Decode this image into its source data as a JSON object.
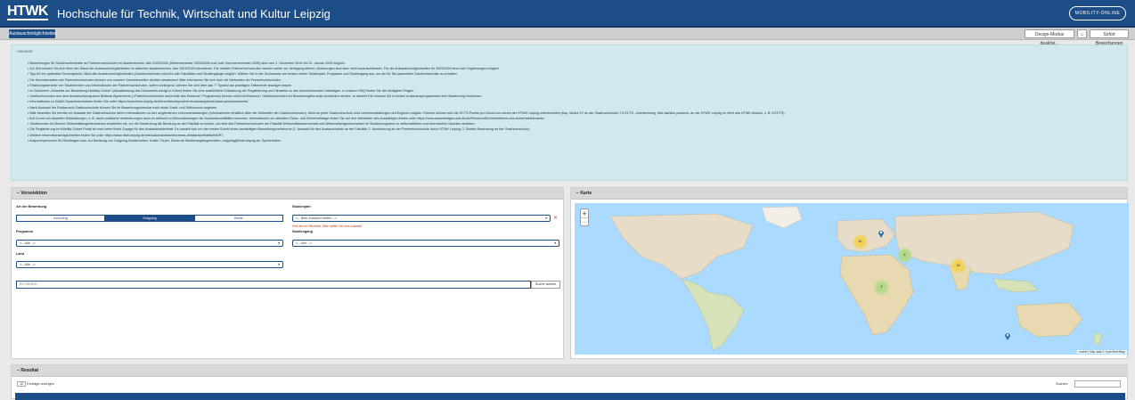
{
  "header": {
    "logo": "HTWK",
    "title": "Hochschule für Technik, Wirtschaft und Kultur Leipzig",
    "partner_logo": "MOBILITY-ONLINE"
  },
  "toolbar": {
    "left_button": "Austauschmöglichkeiten",
    "design_mode": "Design-Modus deaktivi...",
    "home_icon": "home-icon",
    "fav_button": "Sofort Bewerbungen"
  },
  "info": {
    "title": "HINWEISE",
    "items": [
      "Bewerbungen für Studienaufenthalte an Partnerhochschulen im Akademischen Jahr 2025/2026 (Wintersemester 2025/2026 und/ oder Sommersemester 2026) sind vom 1. Dezember 2024 bis 31. Januar 2025 möglich.",
      "Zur Zeit können Sie sich über den Stand der Austauschmöglichkeiten im aktuellen Akademischen Jahr 2024/2025 informieren. Die meisten Partnerhochschulen werden weiter zur Verfügung stehen, Änderungen sind aber nicht auszuschliessen. Für die Austauschmöglichkeiten für 2025/2026 sind noch Ergänzungen möglich.",
      "Tipp für ein optimales Suchergebnis: Nicht alle Austauschmöglichkeiten (Gasthochschulen) sind für alle Fakultäten und Studiengänge möglich. Wählen Sie in der Suchmaske am besten immer Studienjahr, Programm und Studiengang aus, um die für Sie passenden Gasthochschulen zu erhalten.",
      "Die Semesterzeiten der Partnerhochschulen können von unseren Semesterzeiten deutlich abweichen! Bitte informieren Sie sich über die Webseiten der Partnerhochschulen.",
      "Erfahrungsberichte von Studierenden und Informationen der Partnerhochschulen, sofern vorliegend, können Sie sich über das \"i\" Symbol am jeweiligen Zeilenende anzeigen lassen.",
      "Im Dokument „Hinweise zur Bewerbung Mobility-Online\" (Aktualisierung des Dokuments erfolgt in Kürze) finden Sie eine ausführliche Erläuterung der Registrierung und Hinweise zu den einzureichenden Unterlagen. In unseren FAQ finden Sie die häufigsten Fragen.",
      "Gasthochschulen aus dem Austauschprogramm Bilateral Agreements (=Partnerhochschulen außerhalb des Erasmus+ Programms) können nicht mit Erasmus+ Gasthochschulen im Bewerbungsformular kombiniert werden. In diesem Fall müssen Sie in beiden Austauschprogrammen eine Bewerbung einreichen.",
      "Informationen zu DAAD-Sprachnachweisen finden Sie unter https://www.htwk-leipzig.de/lehren/fremdsprachen/zusatzangebote/daad-sprachnachweis/",
      "Nach Auswahl der Erstwunsch-Gasthochschule können Sie im Bewerbungsformular noch einen Zweit- und Drittwunsch angeben.",
      "Bitte beachten Sie bereits vor Auswahl der Gasthochschule deren Informationen zu den angebotenen Lehrveranstaltungen (Informationen erhältlich über die Webseiten der Gasthochschulen). Nicht an jeder Gasthochschule sind Lehrveranstaltungen auf Englisch möglich. Ebenso können sich die ECTS-Punkte pro Modul von denen der HTWK Leipzig unterscheiden (bsp. Modul XY an der Gasthochschule 7,5 ECTS - Anerkennung, falls fachlich passend, an der HTWK Leipzig im Wert des HTWK-Moduls, z. B. 5 ECTS).",
      "Auf Grund von aktuellen Entwicklungen, z. B. durch politische Veränderungen kann es weltweit zu Einschränkungen der Auslandsmobilitäten kommen. Informationen zur aktuellen Reise- und Sicherheitslage finden Sie auf den Webseiten des Auswärtigen Amtes unter https://www.auswaertiges-amt.de/de/ReiseUndSicherheit/reise-und-sicherheitshinweise.",
      "Studierenden im Bereich Wirtschaftsingenieurwesen empfehlen wir, vor der Bewerbung die Beratung an der Fakultät zu nutzen, da nicht alle Partnerhochschulen der Fakultät Wirtschaftswissenschaft und Wirtschaftsingenieurwesen im Studienprogramm in wirtschaftlichen und technischen Modulen anbieten.",
      "Die Registrierung im Mobility-Online Portal ist noch keine finale Zusage für den Auslandsaufenthalt. Es handelt sich um den ersten Schritt eines zweistufigen Bewerbungsverfahrens (1. Auswahl für den Austauschplatz an der Fakultät; 2. Nominierung an der Partnerhochschule durch HTWK Leipzig; 3. Direkte Bewerbung an der Gasthochschule).",
      "Weitere Informationsmöglichkeiten finden Sie unter https://www.htwk-leipzig.de/international/aktuelles/news-detailansicht/artikel/6297.",
      "Ansprechpersonen für Rückfragen bzw. zur Beratung von Outgoing-Studierenden: Kristin Törpel, Dezernat Studienangelegenheiten, outgoing@htwk-leipzig.de, Sprechzeiten"
    ]
  },
  "vorselektion": {
    "title": "Vorselektion",
    "collapse_icon": "minus-icon",
    "art_label": "Art der Bewerbung",
    "art_options": [
      "Incoming",
      "Outgoing",
      "Beide"
    ],
    "art_selected": "Outgoing",
    "studienjahr_label": "Studienjahr",
    "studienjahr_value": "<-- Bitte Auswahl treffen -->",
    "studienjahr_error": "Dies ist ein Pflichtfeld. Bitte treffen Sie eine Auswahl.",
    "programm_label": "Programm",
    "programm_value": "<-- Alle -->",
    "studiengang_label": "Studiengang",
    "studiengang_value": "<-- Alle -->",
    "land_label": "Land",
    "land_value": "<-- Alle -->",
    "keyword_placeholder": "KEYWORD",
    "search_button": "Suche starten"
  },
  "karte": {
    "title": "Karte",
    "zoom_in": "+",
    "zoom_out": "−",
    "attribution": "Leaflet | Map data © OpenStreetMap",
    "clusters": [
      "61",
      "5",
      "14",
      "2"
    ]
  },
  "resultat": {
    "title": "Resultat",
    "entries_count": "10",
    "entries_label": "Einträge anzeigen",
    "search_label": "Suchen:"
  },
  "colors": {
    "primary": "#1c4d86",
    "info_bg": "#cfe9ec",
    "cluster_yellow": "#f1d357",
    "cluster_green": "#b5d98a"
  }
}
